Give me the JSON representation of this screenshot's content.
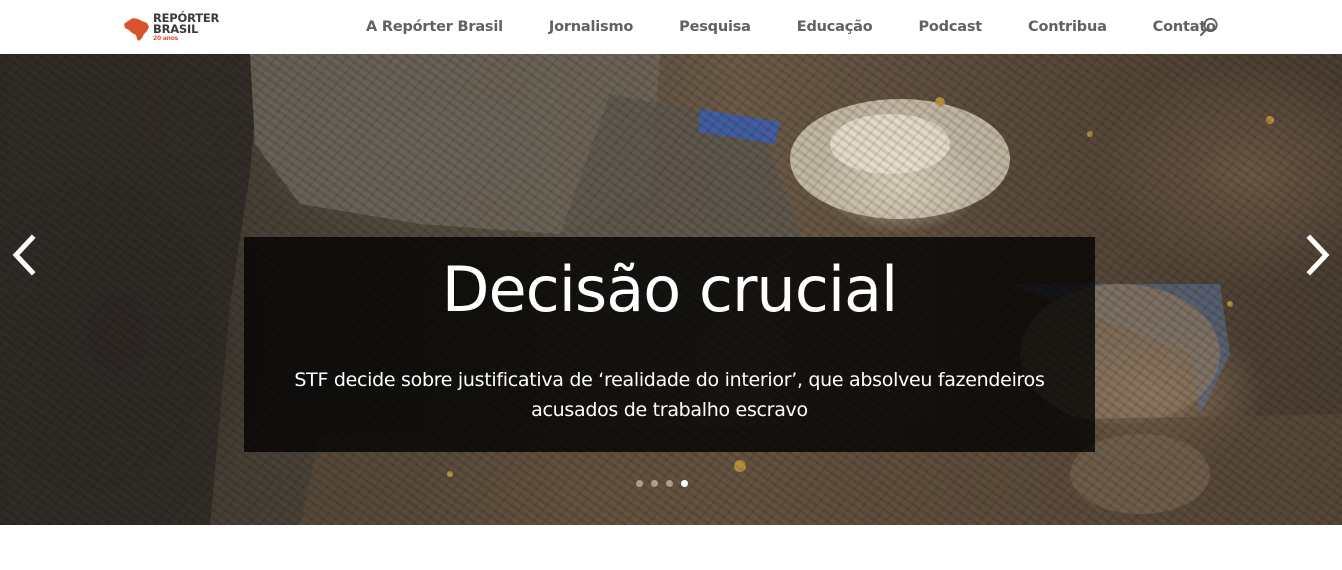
{
  "header": {
    "logo": {
      "line1": "REPÓRTER",
      "line2": "BRASIL",
      "tagline": "20 anos",
      "brand_color": "#d9542b"
    },
    "nav": [
      {
        "label": "A Repórter Brasil"
      },
      {
        "label": "Jornalismo"
      },
      {
        "label": "Pesquisa"
      },
      {
        "label": "Educação"
      },
      {
        "label": "Podcast"
      },
      {
        "label": "Contribua"
      },
      {
        "label": "Contato"
      }
    ],
    "search_icon": "search-icon"
  },
  "slider": {
    "title": "Decisão crucial",
    "text": "STF decide sobre justificativa de ‘realidade do interior’, que absolveu fazendeiros acusados de trabalho escravo",
    "prev_icon": "chevron-left-icon",
    "next_icon": "chevron-right-icon",
    "slide_count": 4,
    "active_slide": 4
  },
  "colors": {
    "nav_text": "#5f6163",
    "caption_bg": "#000000",
    "caption_text": "#ffffff"
  }
}
